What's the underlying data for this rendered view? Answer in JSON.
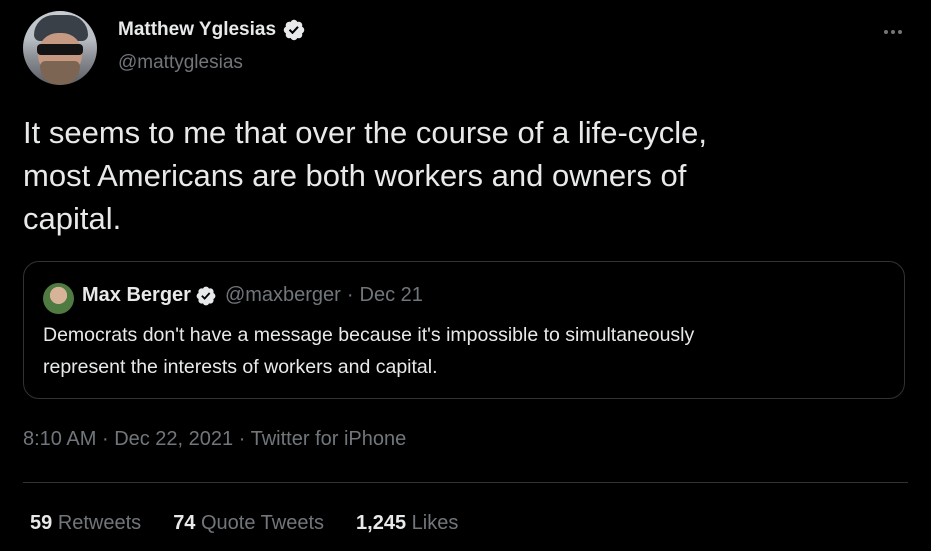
{
  "author": {
    "display_name": "Matthew Yglesias",
    "handle": "@mattyglesias",
    "verified": true
  },
  "tweet": {
    "text_lines": [
      "It seems to me that over the course of a life-cycle,",
      "most Americans are both workers and owners of",
      "capital."
    ]
  },
  "quoted_tweet": {
    "display_name": "Max Berger",
    "handle": "@maxberger",
    "separator": "·",
    "date": "Dec 21",
    "text_lines": [
      "Democrats don't have a message because it's impossible to simultaneously",
      "represent the interests of workers and capital."
    ]
  },
  "meta": {
    "time": "8:10 AM",
    "date": "Dec 22, 2021",
    "source": "Twitter for iPhone",
    "separator": "·"
  },
  "stats": [
    {
      "count": "59",
      "label": "Retweets"
    },
    {
      "count": "74",
      "label": "Quote Tweets"
    },
    {
      "count": "1,245",
      "label": "Likes"
    }
  ],
  "colors": {
    "background": "#000000",
    "text_primary": "#e7e9ea",
    "text_secondary": "#71767b",
    "border": "#2f3336"
  },
  "icons": {
    "verified": "verified-badge-icon",
    "more": "more-horizontal-icon"
  }
}
